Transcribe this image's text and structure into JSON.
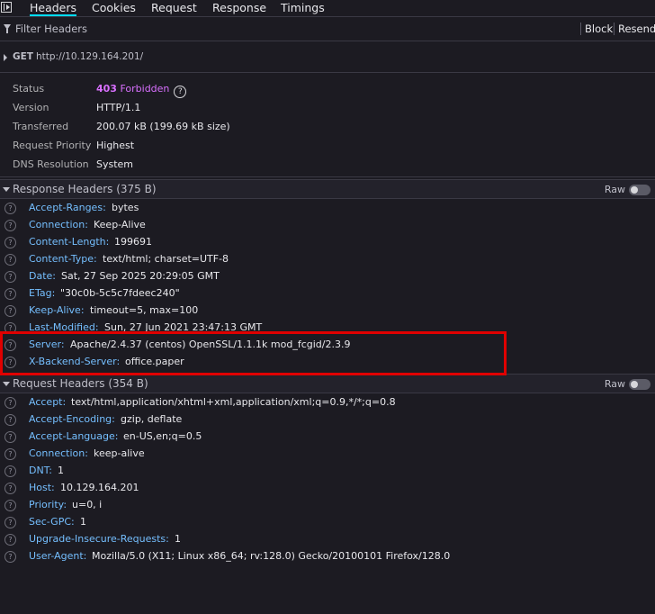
{
  "tabs": [
    "Headers",
    "Cookies",
    "Request",
    "Response",
    "Timings"
  ],
  "toolbar": {
    "filter_placeholder": "Filter Headers",
    "block_label": "Block",
    "resend_label": "Resend"
  },
  "request_line": {
    "method": "GET",
    "url": "http://10.129.164.201/"
  },
  "summary": {
    "status_label": "Status",
    "status_code": "403",
    "status_text": "Forbidden",
    "version_label": "Version",
    "version_value": "HTTP/1.1",
    "transferred_label": "Transferred",
    "transferred_value": "200.07 kB (199.69 kB size)",
    "priority_label": "Request Priority",
    "priority_value": "Highest",
    "dns_label": "DNS Resolution",
    "dns_value": "System"
  },
  "response_headers": {
    "title": "Response Headers (375 B)",
    "raw_label": "Raw",
    "items": [
      {
        "name": "Accept-Ranges",
        "value": "bytes"
      },
      {
        "name": "Connection",
        "value": "Keep-Alive"
      },
      {
        "name": "Content-Length",
        "value": "199691"
      },
      {
        "name": "Content-Type",
        "value": "text/html; charset=UTF-8"
      },
      {
        "name": "Date",
        "value": "Sat, 27 Sep 2025 20:29:05 GMT"
      },
      {
        "name": "ETag",
        "value": "\"30c0b-5c5c7fdeec240\""
      },
      {
        "name": "Keep-Alive",
        "value": "timeout=5, max=100"
      },
      {
        "name": "Last-Modified",
        "value": "Sun, 27 Jun 2021 23:47:13 GMT"
      },
      {
        "name": "Server",
        "value": "Apache/2.4.37 (centos) OpenSSL/1.1.1k mod_fcgid/2.3.9"
      },
      {
        "name": "X-Backend-Server",
        "value": "office.paper"
      }
    ]
  },
  "request_headers": {
    "title": "Request Headers (354 B)",
    "raw_label": "Raw",
    "items": [
      {
        "name": "Accept",
        "value": "text/html,application/xhtml+xml,application/xml;q=0.9,*/*;q=0.8"
      },
      {
        "name": "Accept-Encoding",
        "value": "gzip, deflate"
      },
      {
        "name": "Accept-Language",
        "value": "en-US,en;q=0.5"
      },
      {
        "name": "Connection",
        "value": "keep-alive"
      },
      {
        "name": "DNT",
        "value": "1"
      },
      {
        "name": "Host",
        "value": "10.129.164.201"
      },
      {
        "name": "Priority",
        "value": "u=0, i"
      },
      {
        "name": "Sec-GPC",
        "value": "1"
      },
      {
        "name": "Upgrade-Insecure-Requests",
        "value": "1"
      },
      {
        "name": "User-Agent",
        "value": "Mozilla/5.0 (X11; Linux x86_64; rv:128.0) Gecko/20100101 Firefox/128.0"
      }
    ]
  },
  "help_glyph": "?",
  "colors": {
    "accent": "#00ddff",
    "header_name": "#75bfff",
    "status": "#d970ff",
    "highlight": "#e00000"
  }
}
